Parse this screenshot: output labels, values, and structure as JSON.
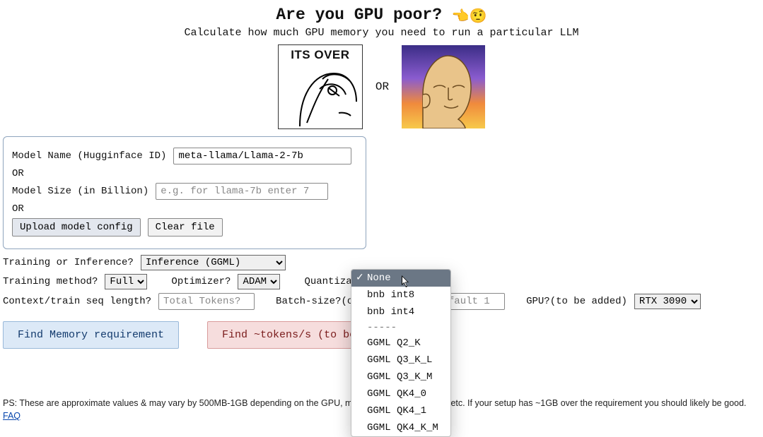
{
  "header": {
    "title": "Are you GPU poor?",
    "emoji": "👈🤨",
    "subtitle": "Calculate how much GPU memory you need to run a particular LLM",
    "meme_left_caption": "ITS OVER",
    "or": "OR"
  },
  "model_box": {
    "name_label": "Model Name (Hugginface ID)",
    "name_value": "meta-llama/Llama-2-7b",
    "or1": "OR",
    "size_label": "Model Size (in Billion)",
    "size_placeholder": "e.g. for llama-7b enter 7",
    "size_value": "",
    "or2": "OR",
    "upload_btn": "Upload model config",
    "clear_btn": "Clear file"
  },
  "controls": {
    "mode_label": "Training or Inference?",
    "mode_value": "Inference (GGML)",
    "train_method_label": "Training method?",
    "train_method_value": "Full",
    "optimizer_label": "Optimizer?",
    "optimizer_value": "ADAM",
    "quant_label": "Quantization?",
    "quant_selected": "None",
    "quant_options": [
      "None",
      "bnb int8",
      "bnb int4",
      "-----",
      "GGML Q2_K",
      "GGML Q3_K_L",
      "GGML Q3_K_M",
      "GGML QK4_0",
      "GGML QK4_1",
      "GGML QK4_K_M"
    ],
    "ctx_label": "Context/train seq length?",
    "ctx_placeholder": "Total Tokens?",
    "ctx_value": "",
    "batch_label": "Batch-size?(only for trn)",
    "batch_placeholder": "default 1",
    "batch_value": "",
    "gpu_label": "GPU?(to be added)",
    "gpu_value": "RTX 3090"
  },
  "actions": {
    "find_memory": "Find Memory requirement",
    "find_tokens": "Find ~tokens/s (to be added)"
  },
  "footer": {
    "note": "PS: These are approximate values & may vary by 500MB-1GB depending on the GPU, model, input, cuda version etc. If your setup has ~1GB over the requirement you should likely be good.",
    "faq": "FAQ"
  }
}
